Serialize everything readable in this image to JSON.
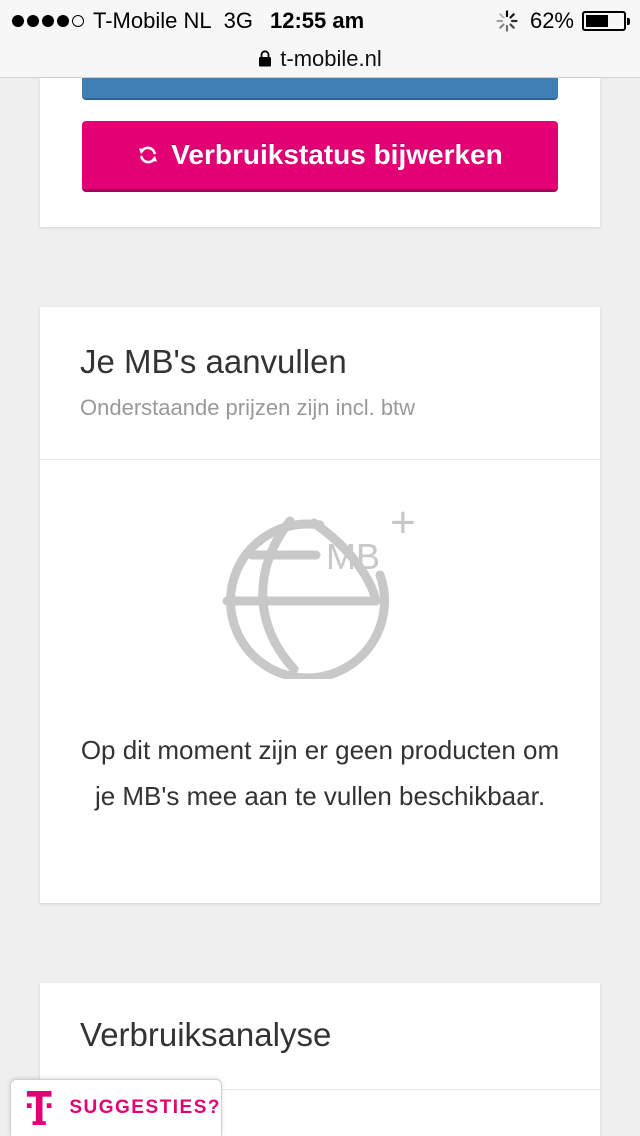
{
  "status_bar": {
    "carrier": "T-Mobile NL",
    "network": "3G",
    "time": "12:55 am",
    "battery_percent": "62%",
    "battery_level": 0.62,
    "signal_bars": 4,
    "signal_max": 5
  },
  "url_bar": {
    "domain": "t-mobile.nl"
  },
  "usage_card": {
    "update_button_label": "Verbruikstatus bijwerken"
  },
  "topup_card": {
    "title": "Je MB's aanvullen",
    "subtitle": "Onderstaande prijzen zijn incl. btw",
    "icon_text": "MB",
    "icon_plus": "+",
    "empty_message": "Op dit moment zijn er geen producten om je MB's mee aan te vullen beschikbaar."
  },
  "analysis_card": {
    "title": "Verbruiksanalyse"
  },
  "suggestion_tab": {
    "label": "SUGGESTIES?",
    "logo_letter": "T"
  },
  "colors": {
    "brand": "#e20074",
    "blue_button": "#3f7fb5",
    "background": "#efefef"
  }
}
